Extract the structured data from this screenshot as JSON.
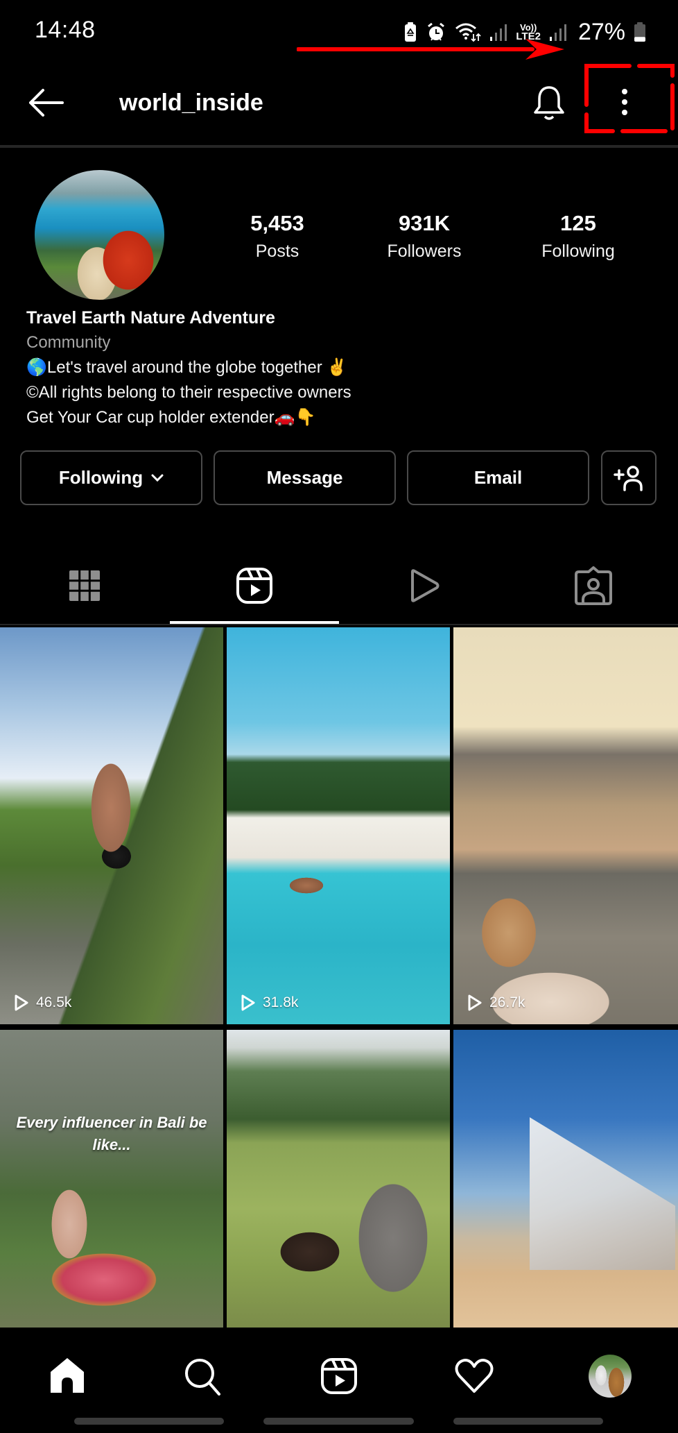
{
  "status_bar": {
    "time": "14:48",
    "icons": [
      "battery-saver-icon",
      "alarm-icon",
      "wifi-icon",
      "signal-icon",
      "volte-lte2-icon",
      "signal-icon"
    ],
    "network_label_top": "Vo))",
    "network_label_bottom": "LTE2",
    "battery_percent": "27%",
    "battery_level": 0.27
  },
  "header": {
    "back_icon": "arrow-left-icon",
    "username": "world_inside",
    "bell_icon": "bell-icon",
    "more_icon": "more-vertical-icon",
    "annotation_color": "#ff0000"
  },
  "profile": {
    "avatar_alt": "Profile picture: person in red jacket with dog overlooking a lake",
    "stats": [
      {
        "value": "5,453",
        "label": "Posts"
      },
      {
        "value": "931K",
        "label": "Followers"
      },
      {
        "value": "125",
        "label": "Following"
      }
    ],
    "name": "Travel Earth Nature Adventure",
    "category": "Community",
    "bio_lines": [
      "🌎Let's travel around the globe together ✌️",
      "©All rights belong to their respective owners",
      "Get Your Car cup holder extender🚗👇"
    ]
  },
  "actions": {
    "following_label": "Following",
    "message_label": "Message",
    "email_label": "Email",
    "add_user_icon": "add-user-icon"
  },
  "tabs": [
    {
      "name": "grid",
      "icon": "grid-icon",
      "active": false
    },
    {
      "name": "reels",
      "icon": "reels-icon",
      "active": true
    },
    {
      "name": "videos",
      "icon": "play-icon",
      "active": false
    },
    {
      "name": "tagged",
      "icon": "tagged-user-icon",
      "active": false
    }
  ],
  "grid": {
    "tiles": [
      {
        "views": "46.5k",
        "description": "Man jumping off a rocky cliff near trees"
      },
      {
        "views": "31.8k",
        "description": "Person diving into turquoise water off white sand beach"
      },
      {
        "views": "26.7k",
        "description": "Woman in infinity pool overlooking coastal town"
      },
      {
        "views": "",
        "overlay_text": "Every influencer in Bali be like...",
        "description": "Man in flower bath in jungle"
      },
      {
        "views": "",
        "description": "Woman bowing with baby elephant on grass field"
      },
      {
        "views": "",
        "description": "Acrobatic pose in desert next to mirrored building"
      }
    ]
  },
  "bottom_nav": {
    "items": [
      {
        "name": "home",
        "icon": "home-icon"
      },
      {
        "name": "search",
        "icon": "search-icon"
      },
      {
        "name": "reels",
        "icon": "reels-icon"
      },
      {
        "name": "activity",
        "icon": "heart-icon"
      },
      {
        "name": "profile",
        "icon": "profile-avatar"
      }
    ]
  }
}
